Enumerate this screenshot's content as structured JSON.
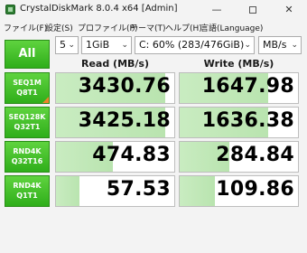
{
  "window": {
    "title": "CrystalDiskMark 8.0.4 x64 [Admin]",
    "minimize": "—",
    "close": "✕"
  },
  "menu": [
    {
      "label": "ファイル(F)"
    },
    {
      "label": "設定(S)"
    },
    {
      "label": "プロファイル(P)"
    },
    {
      "label": "テーマ(T)"
    },
    {
      "label": "ヘルプ(H)"
    },
    {
      "label": "言語(Language)"
    }
  ],
  "controls": {
    "all_label": "All",
    "count": "5",
    "size": "1GiB",
    "drive": "C: 60% (283/476GiB)",
    "unit": "MB/s",
    "arrow": "⌄"
  },
  "headers": {
    "read": "Read (MB/s)",
    "write": "Write (MB/s)"
  },
  "rows": [
    {
      "line1": "SEQ1M",
      "line2": "Q8T1",
      "read": "3430.76",
      "write": "1647.98",
      "read_level": 0.92,
      "write_level": 0.75
    },
    {
      "line1": "SEQ128K",
      "line2": "Q32T1",
      "read": "3425.18",
      "write": "1636.38",
      "read_level": 0.92,
      "write_level": 0.75
    },
    {
      "line1": "RND4K",
      "line2": "Q32T16",
      "read": "474.83",
      "write": "284.84",
      "read_level": 0.48,
      "write_level": 0.42
    },
    {
      "line1": "RND4K",
      "line2": "Q1T1",
      "read": "57.53",
      "write": "109.86",
      "read_level": 0.2,
      "write_level": 0.3
    }
  ]
}
